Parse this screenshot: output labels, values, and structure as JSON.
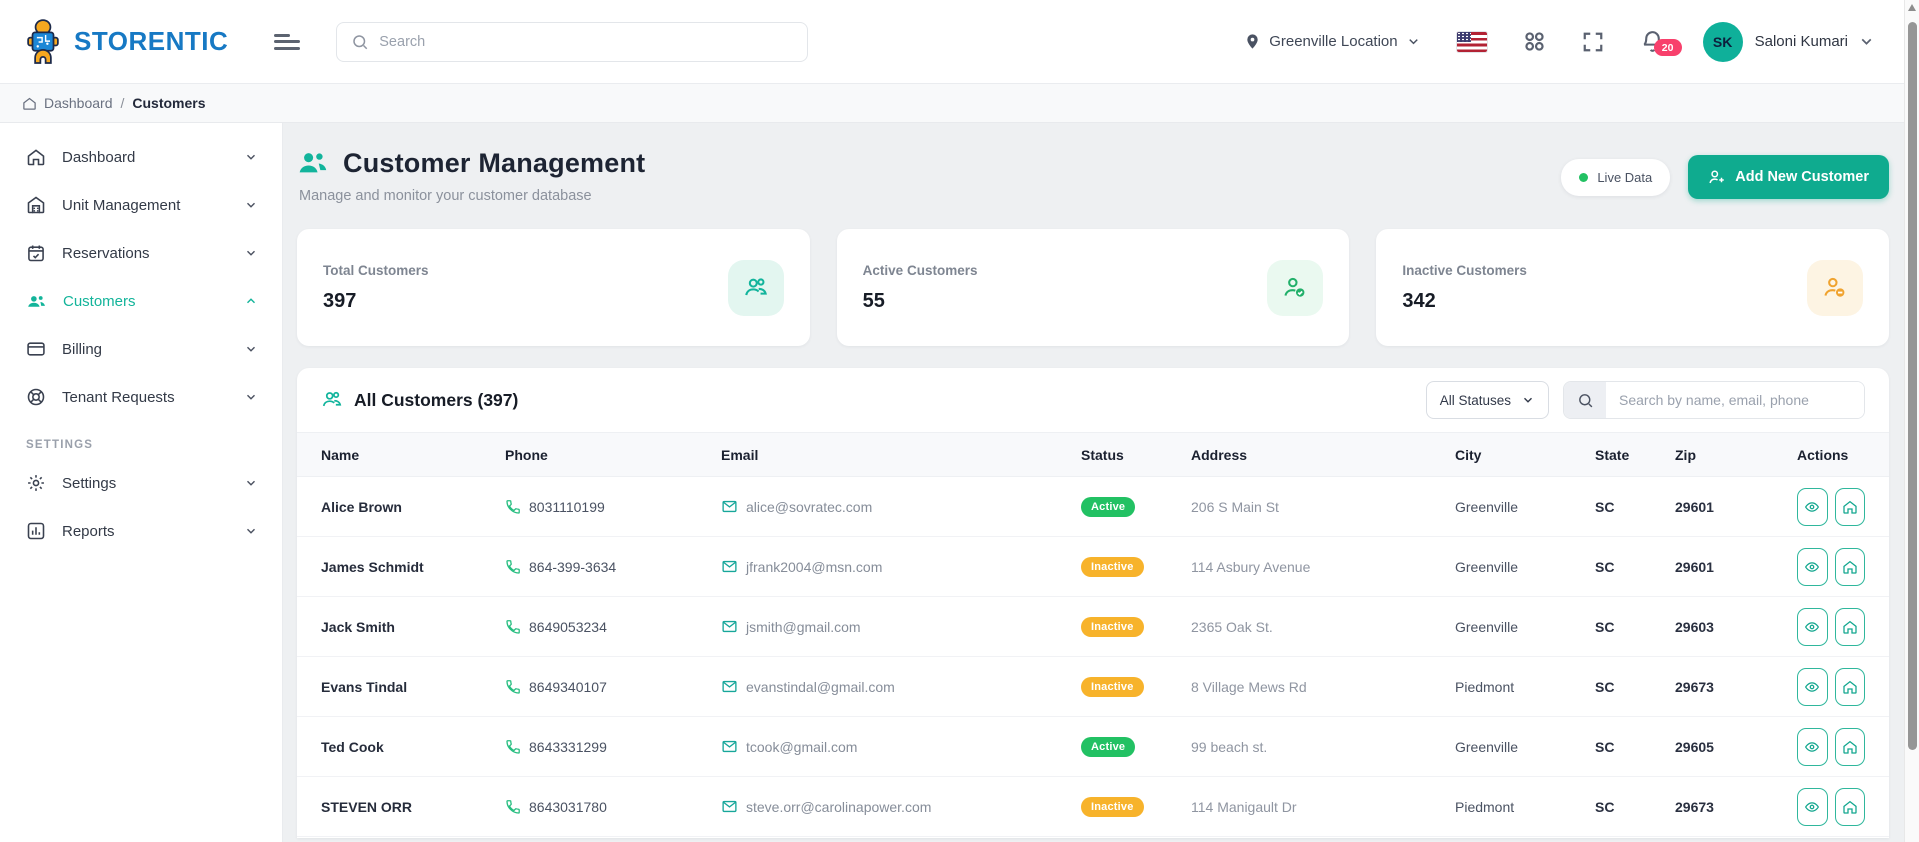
{
  "brand": {
    "name": "STORENTIC"
  },
  "header": {
    "search_placeholder": "Search",
    "location_label": "Greenville Location",
    "notification_count": "20",
    "user_initials": "SK",
    "user_name": "Saloni Kumari"
  },
  "breadcrumb": {
    "dashboard": "Dashboard",
    "separator": "/",
    "current": "Customers"
  },
  "sidebar": {
    "items": [
      {
        "label": "Dashboard"
      },
      {
        "label": "Unit Management"
      },
      {
        "label": "Reservations"
      },
      {
        "label": "Customers"
      },
      {
        "label": "Billing"
      },
      {
        "label": "Tenant Requests"
      }
    ],
    "section_label": "SETTINGS",
    "settings_items": [
      {
        "label": "Settings"
      },
      {
        "label": "Reports"
      }
    ]
  },
  "page": {
    "title": "Customer Management",
    "subtitle": "Manage and monitor your customer database",
    "live_badge_label": "Live Data",
    "add_button_label": "Add New Customer"
  },
  "stats": [
    {
      "label": "Total Customers",
      "value": "397",
      "icon": "users-icon"
    },
    {
      "label": "Active Customers",
      "value": "55",
      "icon": "user-check-icon"
    },
    {
      "label": "Inactive Customers",
      "value": "342",
      "icon": "user-minus-icon"
    }
  ],
  "table": {
    "title": "All Customers (397)",
    "filter_value": "All Statuses",
    "search_placeholder": "Search by name, email, phone",
    "columns": [
      "Name",
      "Phone",
      "Email",
      "Status",
      "Address",
      "City",
      "State",
      "Zip",
      "Actions"
    ],
    "rows": [
      {
        "name": "Alice Brown",
        "phone": "8031110199",
        "email": "alice@sovratec.com",
        "status": "Active",
        "address": "206 S Main St",
        "city": "Greenville",
        "state": "SC",
        "zip": "29601"
      },
      {
        "name": "James Schmidt",
        "phone": "864-399-3634",
        "email": "jfrank2004@msn.com",
        "status": "Inactive",
        "address": "114 Asbury Avenue",
        "city": "Greenville",
        "state": "SC",
        "zip": "29601"
      },
      {
        "name": "Jack Smith",
        "phone": "8649053234",
        "email": "jsmith@gmail.com",
        "status": "Inactive",
        "address": "2365 Oak St.",
        "city": "Greenville",
        "state": "SC",
        "zip": "29603"
      },
      {
        "name": "Evans Tindal",
        "phone": "8649340107",
        "email": "evanstindal@gmail.com",
        "status": "Inactive",
        "address": "8 Village Mews Rd",
        "city": "Piedmont",
        "state": "SC",
        "zip": "29673"
      },
      {
        "name": "Ted Cook",
        "phone": "8643331299",
        "email": "tcook@gmail.com",
        "status": "Active",
        "address": "99 beach st.",
        "city": "Greenville",
        "state": "SC",
        "zip": "29605"
      },
      {
        "name": "STEVEN ORR",
        "phone": "8643031780",
        "email": "steve.orr@carolinapower.com",
        "status": "Inactive",
        "address": "114 Manigault Dr",
        "city": "Piedmont",
        "state": "SC",
        "zip": "29673"
      }
    ]
  },
  "colors": {
    "accent_teal": "#0fab8f",
    "active_badge": "#22c163",
    "inactive_badge": "#f7b32b",
    "notification_badge": "#f8406c",
    "logo_blue": "#1779c4",
    "logo_orange": "#f6a81f"
  }
}
